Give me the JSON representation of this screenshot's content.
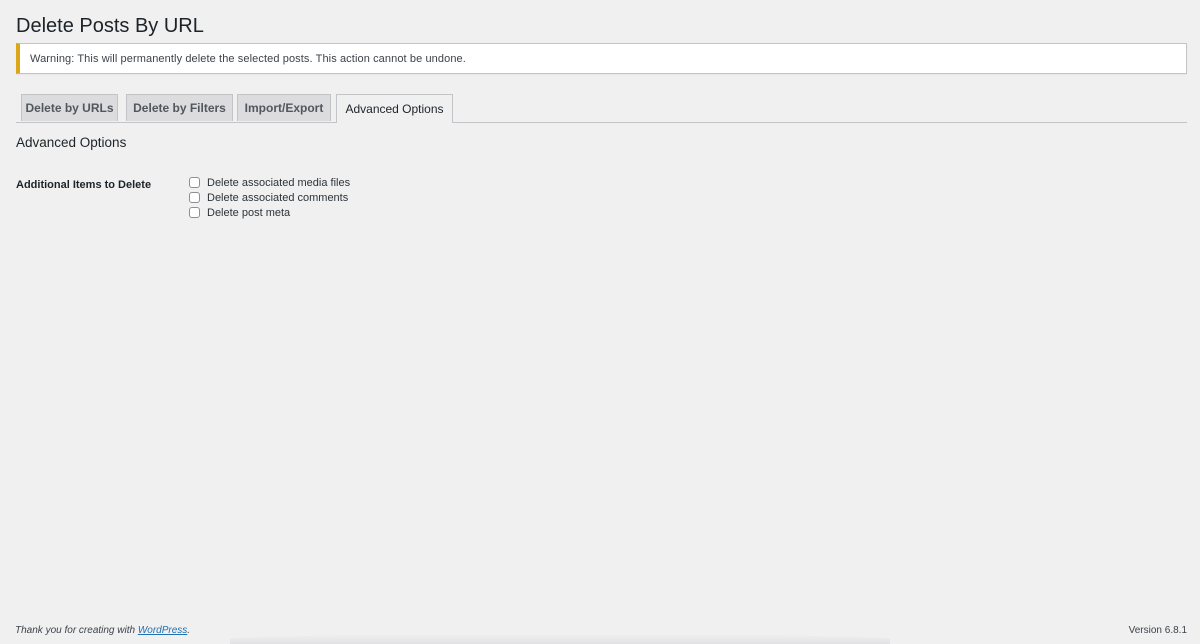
{
  "page": {
    "title": "Delete Posts By URL"
  },
  "notice": {
    "text": "Warning: This will permanently delete the selected posts. This action cannot be undone.",
    "accent_color": "#dba617"
  },
  "tabs": [
    {
      "label": "Delete by URLs",
      "active": false
    },
    {
      "label": "Delete by Filters",
      "active": false
    },
    {
      "label": "Import/Export",
      "active": false
    },
    {
      "label": "Advanced Options",
      "active": true
    }
  ],
  "advanced": {
    "heading": "Advanced Options",
    "field_label": "Additional Items to Delete",
    "options": [
      {
        "label": "Delete associated media files",
        "checked": false
      },
      {
        "label": "Delete associated comments",
        "checked": false
      },
      {
        "label": "Delete post meta",
        "checked": false
      }
    ]
  },
  "footer": {
    "thanks_prefix": "Thank you for creating with ",
    "thanks_link": "WordPress",
    "thanks_suffix": ".",
    "version": "Version 6.8.1",
    "link_color": "#2271b1"
  }
}
